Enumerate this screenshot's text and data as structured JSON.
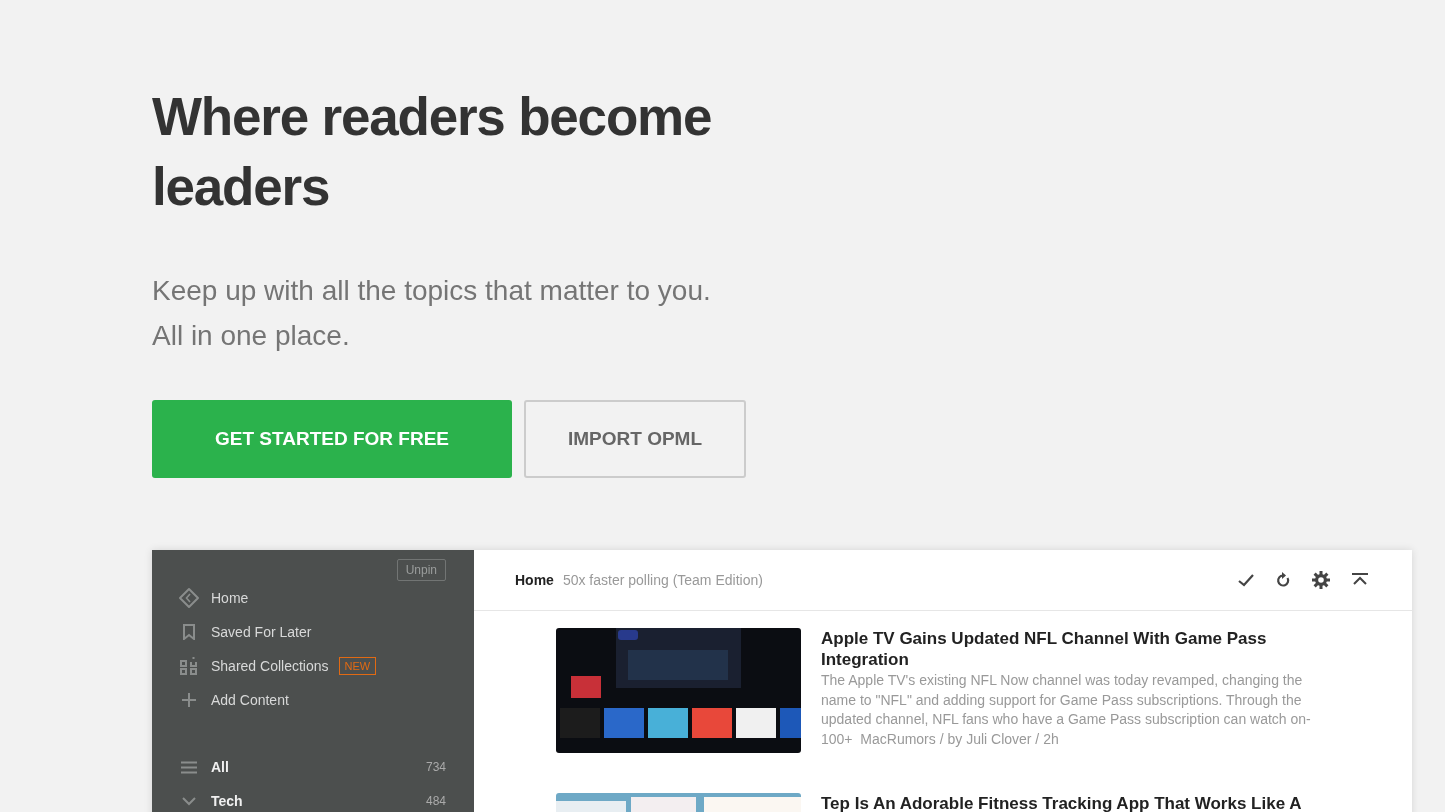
{
  "hero": {
    "headline": "Where readers become leaders",
    "subtitle_lines": [
      "Keep up with all the topics that matter to you.",
      "All in one place."
    ],
    "buttons": [
      {
        "label": "GET STARTED FOR FREE",
        "kind": "primary"
      },
      {
        "label": "IMPORT OPML",
        "kind": "secondary"
      }
    ]
  },
  "app": {
    "sidebar": {
      "unpin": "Unpin",
      "nav": [
        {
          "label": "Home"
        },
        {
          "label": "Saved For Later"
        },
        {
          "label": "Shared Collections",
          "badge": "NEW"
        },
        {
          "label": "Add Content"
        }
      ],
      "feeds": [
        {
          "label": "All",
          "count": "734",
          "kind": "list"
        },
        {
          "label": "Tech",
          "count": "484",
          "kind": "folder",
          "expanded": true
        }
      ]
    },
    "header": {
      "title": "Home",
      "subtitle": "50x faster polling (Team Edition)"
    },
    "articles": [
      {
        "title": "Apple TV Gains Updated NFL Channel With Game Pass Integration",
        "summary": "The Apple TV's existing NFL Now channel was today revamped, changing the name to \"NFL\" and adding support for Game Pass subscriptions. Through the updated channel, NFL fans who have a Game Pass subscription can watch on-100+",
        "meta": "MacRumors / by Juli Clover / 2h",
        "kind": "picture"
      },
      {
        "title": "Tep Is An Adorable Fitness Tracking App That Works Like A",
        "kind": "picture"
      }
    ]
  }
}
